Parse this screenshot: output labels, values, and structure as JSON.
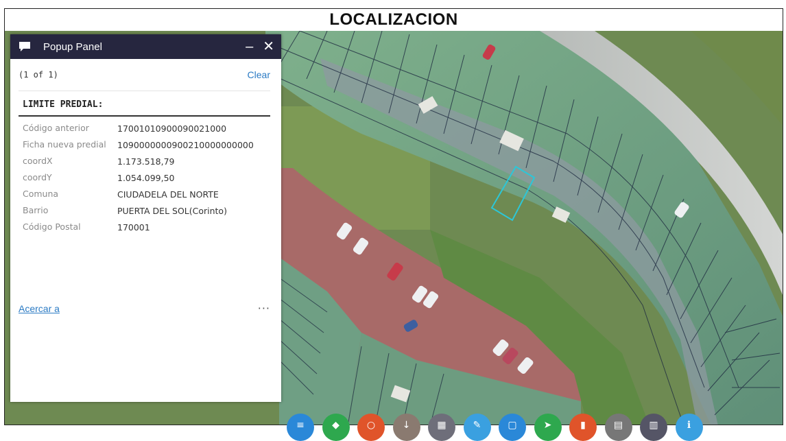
{
  "document": {
    "title": "LOCALIZACION"
  },
  "popup": {
    "title": "Popup Panel",
    "minimize_label": "–",
    "close_label": "✕",
    "pagination": "(1 of 1)",
    "clear_label": "Clear",
    "layer_title": "LIMITE PREDIAL:",
    "attributes": [
      {
        "key": "Código anterior",
        "value": "17001010900090021000"
      },
      {
        "key": "Ficha nueva predial",
        "value": "1090000000900210000000000"
      },
      {
        "key": "coordX",
        "value": "1.173.518,79"
      },
      {
        "key": "coordY",
        "value": "1.054.099,50"
      },
      {
        "key": "Comuna",
        "value": "CIUDADELA DEL NORTE"
      },
      {
        "key": "Barrio",
        "value": "PUERTA DEL SOL(Corinto)"
      },
      {
        "key": "Código Postal",
        "value": "170001"
      }
    ],
    "zoom_label": "Acercar a",
    "more_label": "···"
  },
  "toolbar": {
    "buttons": [
      {
        "icon": "list-icon",
        "color": "#2a88d8"
      },
      {
        "icon": "layers-icon",
        "color": "#2ea84e"
      },
      {
        "icon": "search-icon",
        "color": "#e0542a"
      },
      {
        "icon": "measure-icon",
        "color": "#8a7a70"
      },
      {
        "icon": "grid-icon",
        "color": "#6e6e7a"
      },
      {
        "icon": "draw-icon",
        "color": "#3aa0e0"
      },
      {
        "icon": "print-icon",
        "color": "#2a88d8"
      },
      {
        "icon": "share-icon",
        "color": "#2ea84e"
      },
      {
        "icon": "bookmark-icon",
        "color": "#e0542a"
      },
      {
        "icon": "basemap-icon",
        "color": "#777777"
      },
      {
        "icon": "table-icon",
        "color": "#555566"
      },
      {
        "icon": "info-icon",
        "color": "#3aa0e0"
      }
    ]
  },
  "colors": {
    "header_bg": "#26263f",
    "link": "#2b7bc4",
    "parcel_highlight": "#2cc7d8",
    "parcel_lines": "#1e2a40"
  }
}
